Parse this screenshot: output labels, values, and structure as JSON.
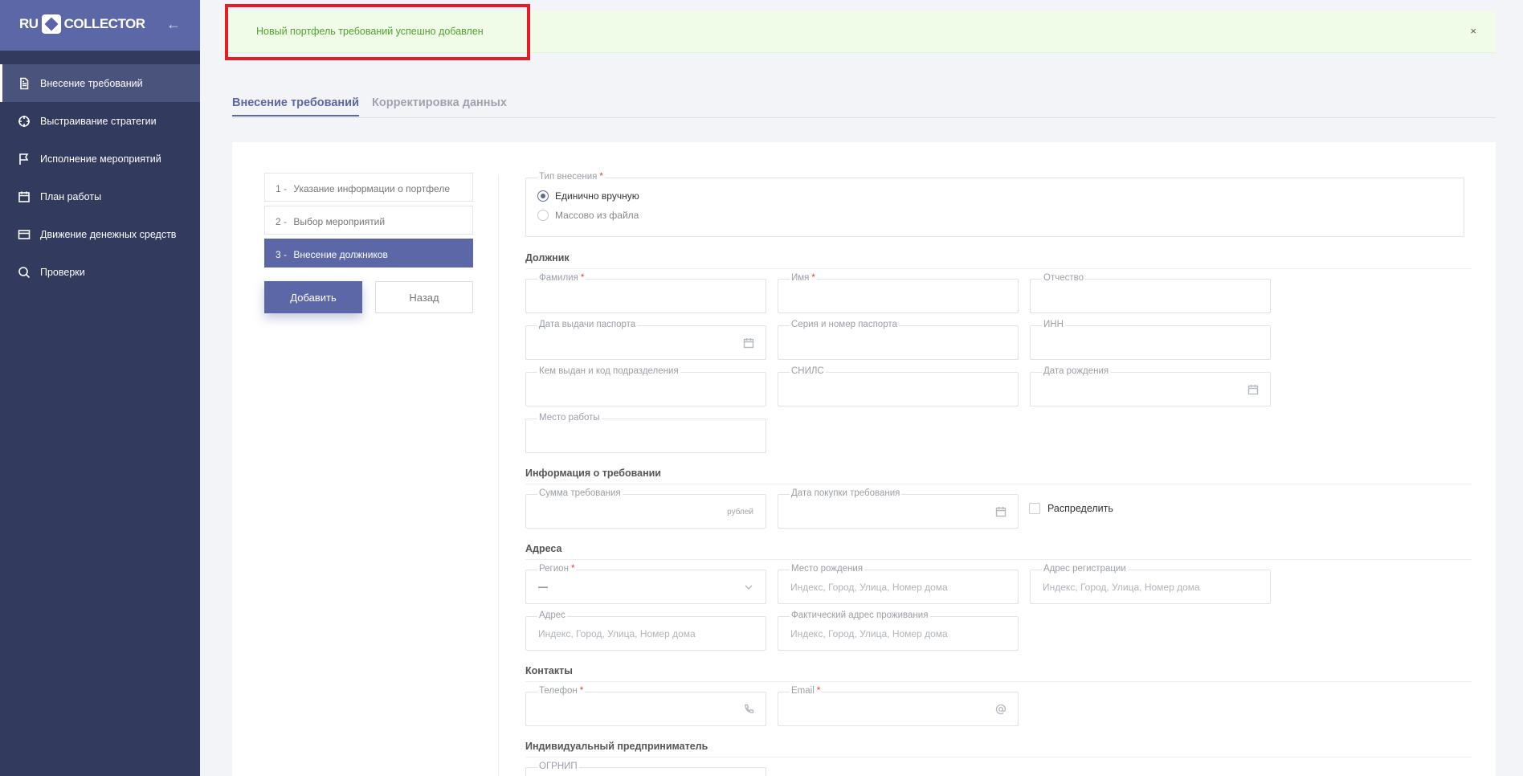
{
  "sidebar": {
    "logo_left": "RU",
    "logo_right": "COLLECTOR",
    "items": [
      {
        "label": "Внесение требований"
      },
      {
        "label": "Выстраивание стратегии"
      },
      {
        "label": "Исполнение мероприятий"
      },
      {
        "label": "План работы"
      },
      {
        "label": "Движение денежных средств"
      },
      {
        "label": "Проверки"
      }
    ]
  },
  "alert": {
    "message": "Новый портфель требований успешно добавлен",
    "close": "×"
  },
  "tabs": [
    "Внесение требований",
    "Корректировка данных"
  ],
  "steps": [
    {
      "num": "1 -",
      "label": "Указание информации о портфеле"
    },
    {
      "num": "2 -",
      "label": "Выбор мероприятий"
    },
    {
      "num": "3 -",
      "label": "Внесение должников"
    }
  ],
  "buttons": {
    "add": "Добавить",
    "back": "Назад"
  },
  "entry_type": {
    "label": "Тип внесения",
    "options": [
      "Единично вручную",
      "Массово из файла"
    ],
    "selected": "Единично вручную"
  },
  "sections": {
    "debtor": "Должник",
    "claim": "Информация о требовании",
    "addresses": "Адреса",
    "contacts": "Контакты",
    "entrepreneur": "Индивидуальный предприниматель"
  },
  "fields": {
    "last_name": "Фамилия",
    "first_name": "Имя",
    "patronymic": "Отчество",
    "passport_date": "Дата выдачи паспорта",
    "passport_number": "Серия и номер паспорта",
    "inn": "ИНН",
    "issued_by": "Кем выдан и код подразделения",
    "snils": "СНИЛС",
    "birth_date": "Дата рождения",
    "workplace": "Место работы",
    "claim_amount": "Сумма требования",
    "claim_amount_suffix": "рублей",
    "purchase_date": "Дата покупки требования",
    "distribute": "Распределить",
    "region": "Регион",
    "region_value": "—",
    "birth_place": "Место рождения",
    "registration_address": "Адрес регистрации",
    "address": "Адрес",
    "actual_address": "Фактический адрес проживания",
    "address_placeholder": "Индекс, Город, Улица, Номер дома",
    "phone": "Телефон",
    "email": "Email",
    "ogrnip": "ОГРНИП",
    "required_mark": "*"
  }
}
